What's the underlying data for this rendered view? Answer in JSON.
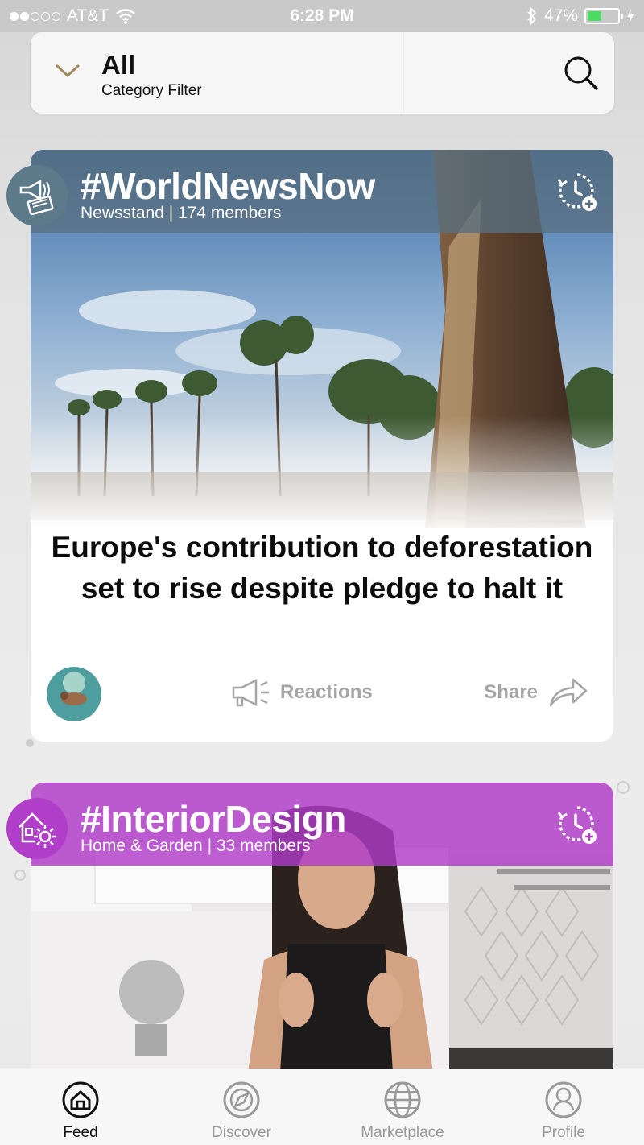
{
  "status_bar": {
    "carrier": "AT&T",
    "time": "6:28 PM",
    "battery": "47%",
    "battery_level": 0.47
  },
  "filter": {
    "title": "All",
    "subtitle": "Category Filter"
  },
  "posts": [
    {
      "title": "#WorldNewsNow",
      "subtitle": "Newsstand | 174 members",
      "headline": "Europe's contribution to deforestation set to rise despite pledge to halt it",
      "reactions_label": "Reactions",
      "share_label": "Share"
    },
    {
      "title": "#InteriorDesign",
      "subtitle": "Home & Garden | 33 members"
    }
  ],
  "tabs": [
    {
      "label": "Feed",
      "icon": "home-icon",
      "active": true
    },
    {
      "label": "Discover",
      "icon": "compass-icon",
      "active": false
    },
    {
      "label": "Marketplace",
      "icon": "globe-icon",
      "active": false
    },
    {
      "label": "Profile",
      "icon": "user-icon",
      "active": false
    }
  ],
  "colors": {
    "news_header": "#587080",
    "design_header": "#b03ac8",
    "chevron": "#a0875a",
    "battery": "#4cd964"
  }
}
